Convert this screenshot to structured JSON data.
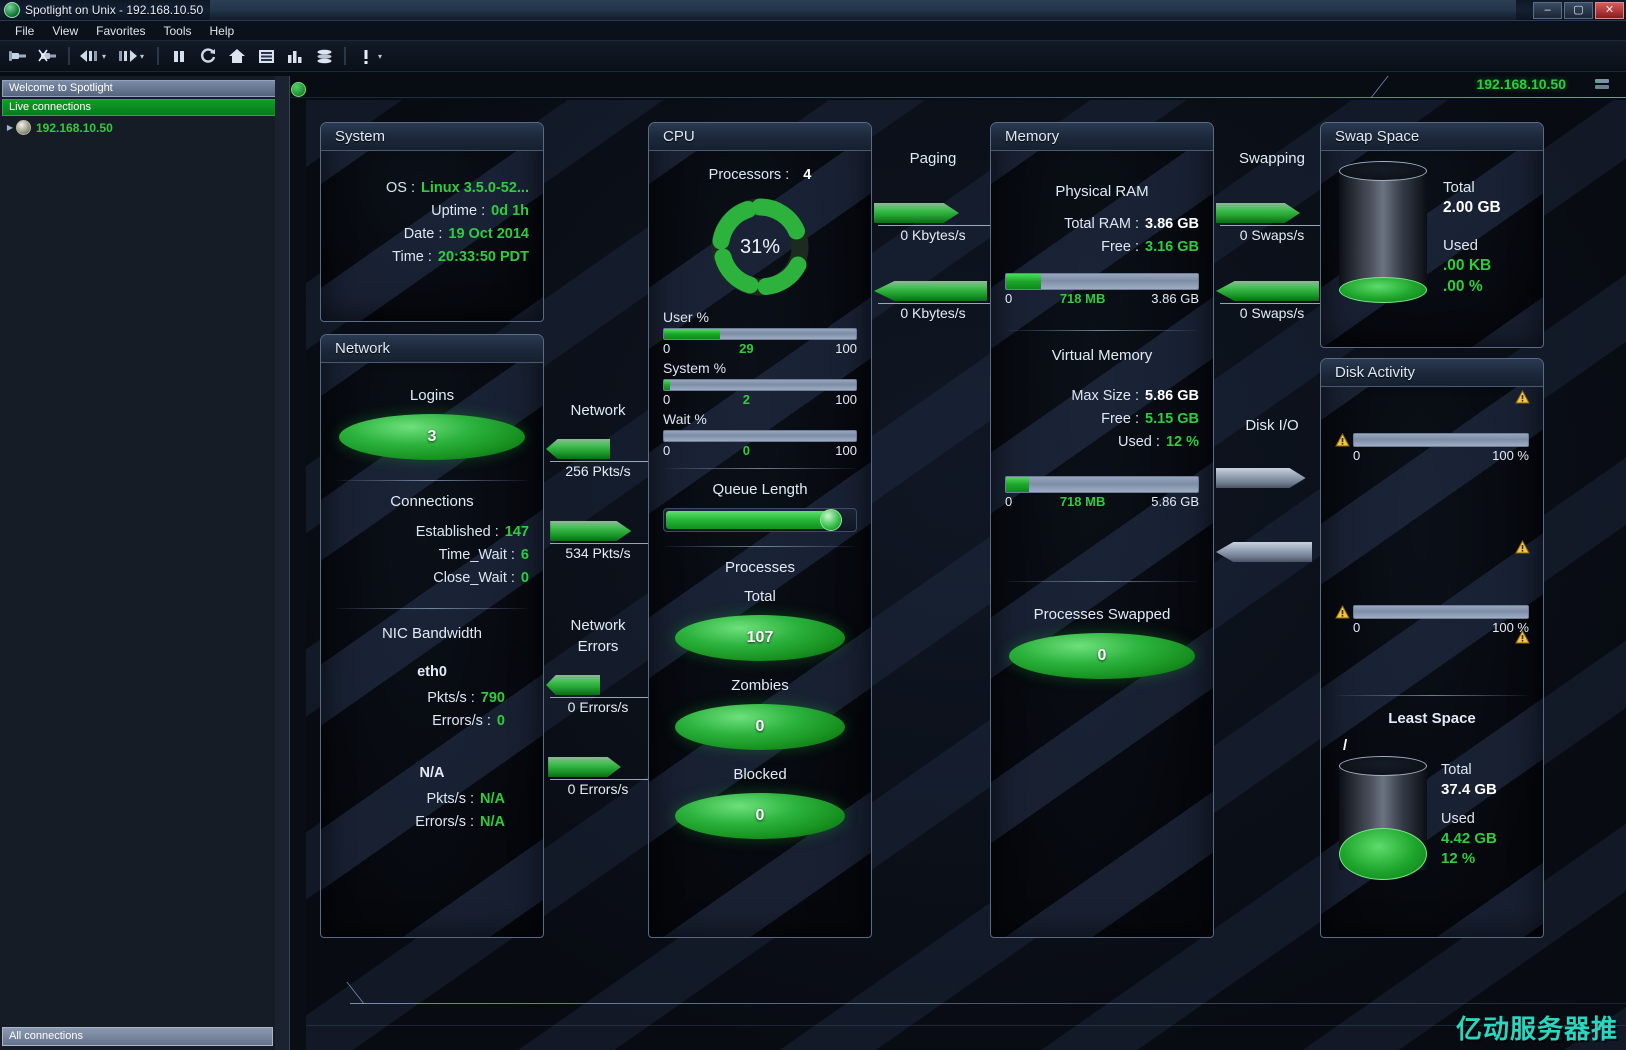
{
  "window": {
    "title": "Spotlight on Unix - 192.168.10.50",
    "minimize": "–",
    "maximize": "▢",
    "close": "✕"
  },
  "menubar": [
    {
      "label": "File"
    },
    {
      "label": "View"
    },
    {
      "label": "Favorites"
    },
    {
      "label": "Tools"
    },
    {
      "label": "Help"
    }
  ],
  "toolbar": [
    {
      "name": "connect-icon",
      "glyph": "⚊"
    },
    {
      "name": "disconnect-icon",
      "glyph": "⚊"
    },
    {
      "name": "back-icon",
      "glyph": "◀"
    },
    {
      "name": "forward-icon",
      "glyph": "▶"
    },
    {
      "name": "pause-icon",
      "glyph": "❚❚"
    },
    {
      "name": "refresh-icon",
      "glyph": "↻"
    },
    {
      "name": "home-icon",
      "glyph": "⌂"
    },
    {
      "name": "grid-icon",
      "glyph": "▤"
    },
    {
      "name": "chart-icon",
      "glyph": "▮"
    },
    {
      "name": "database-icon",
      "glyph": "☰"
    },
    {
      "name": "alarm-icon",
      "glyph": "❗"
    }
  ],
  "banner": {
    "ip": "192.168.10.50"
  },
  "sidebar": {
    "welcome_header": "Welcome to Spotlight",
    "live_connections": "Live connections",
    "node": "192.168.10.50",
    "status": "All connections"
  },
  "system": {
    "title": "System",
    "rows": [
      {
        "label": "OS :",
        "value": "Linux  3.5.0-52...",
        "style": "green"
      },
      {
        "label": "Uptime :",
        "value": "0d 1h",
        "style": "green"
      },
      {
        "label": "Date :",
        "value": "19 Oct 2014",
        "style": "green"
      },
      {
        "label": "Time :",
        "value": "20:33:50 PDT",
        "style": "green"
      }
    ]
  },
  "network_panel": {
    "title": "Network",
    "logins_label": "Logins",
    "logins_value": "3",
    "connections_label": "Connections",
    "connections": [
      {
        "label": "Established :",
        "value": "147"
      },
      {
        "label": "Time_Wait :",
        "value": "6"
      },
      {
        "label": "Close_Wait :",
        "value": "0"
      }
    ],
    "nic_label": "NIC Bandwidth",
    "nics": [
      {
        "name": "eth0",
        "rows": [
          {
            "label": "Pkts/s :",
            "value": "790"
          },
          {
            "label": "Errors/s :",
            "value": "0"
          }
        ]
      },
      {
        "name": "N/A",
        "rows": [
          {
            "label": "Pkts/s :",
            "value": "N/A"
          },
          {
            "label": "Errors/s :",
            "value": "N/A"
          }
        ]
      }
    ]
  },
  "network_flow": {
    "title1": "Network",
    "flows1": [
      {
        "value": "256 Pkts/s",
        "dir": "left",
        "fill": 62
      },
      {
        "value": "534 Pkts/s",
        "dir": "right",
        "fill": 78
      }
    ],
    "title2a": "Network",
    "title2b": "Errors",
    "flows2": [
      {
        "value": "0 Errors/s",
        "dir": "left",
        "fill": 52
      },
      {
        "value": "0 Errors/s",
        "dir": "right",
        "fill": 70
      }
    ]
  },
  "cpu": {
    "title": "CPU",
    "processors_label": "Processors :",
    "processors_value": "4",
    "dial_value": "31%",
    "bars": [
      {
        "label": "User %",
        "min": "0",
        "cur": "29",
        "max": "100",
        "fill": 29
      },
      {
        "label": "System %",
        "min": "0",
        "cur": "2",
        "max": "100",
        "fill": 3
      },
      {
        "label": "Wait %",
        "min": "0",
        "cur": "0",
        "max": "100",
        "fill": 0
      }
    ],
    "queue_label": "Queue Length",
    "queue_fill": 86,
    "processes_label": "Processes",
    "processes": [
      {
        "label": "Total",
        "value": "107"
      },
      {
        "label": "Zombies",
        "value": "0"
      },
      {
        "label": "Blocked",
        "value": "0"
      }
    ]
  },
  "paging": {
    "title": "Paging",
    "flows": [
      {
        "value": "0 Kbytes/s",
        "dir": "right",
        "fill": 72
      },
      {
        "value": "0 Kbytes/s",
        "dir": "left",
        "fill": 96
      }
    ]
  },
  "memory": {
    "title": "Memory",
    "physical_label": "Physical RAM",
    "physical_rows": [
      {
        "label": "Total RAM :",
        "value": "3.86 GB",
        "style": "white"
      },
      {
        "label": "Free :",
        "value": "3.16 GB",
        "style": "green"
      }
    ],
    "physical_meter": {
      "min": "0",
      "cur": "718 MB",
      "max": "3.86 GB",
      "fill": 18
    },
    "virtual_label": "Virtual Memory",
    "virtual_rows": [
      {
        "label": "Max Size :",
        "value": "5.86 GB",
        "style": "white"
      },
      {
        "label": "Free :",
        "value": "5.15 GB",
        "style": "green"
      },
      {
        "label": "Used :",
        "value": "12 %",
        "style": "green"
      }
    ],
    "virtual_meter": {
      "min": "0",
      "cur": "718 MB",
      "max": "5.86 GB",
      "fill": 12
    },
    "swapped_label": "Processes Swapped",
    "swapped_value": "0"
  },
  "swapping": {
    "title": "Swapping",
    "flows": [
      {
        "value": "0 Swaps/s",
        "dir": "right",
        "fill": 75
      },
      {
        "value": "0 Swaps/s",
        "dir": "left",
        "fill": 92
      }
    ]
  },
  "swap_space": {
    "title": "Swap Space",
    "total_label": "Total",
    "total_value": "2.00 GB",
    "used_label": "Used",
    "used_value": ".00 KB",
    "used_pct": ".00 %",
    "fill_pct": 6
  },
  "disk_io": {
    "title": "Disk I/O",
    "flows": [
      {
        "value": "",
        "dir": "right",
        "fill": 80
      },
      {
        "value": "",
        "dir": "left",
        "fill": 86
      }
    ]
  },
  "disk_activity": {
    "title": "Disk Activity",
    "meters": [
      {
        "min": "0",
        "max": "100 %",
        "fill": 0
      },
      {
        "min": "0",
        "max": "100 %",
        "fill": 0
      }
    ],
    "least_space_label": "Least Space",
    "mount": "/",
    "total_label": "Total",
    "total_value": "37.4 GB",
    "used_label": "Used",
    "used_value": "4.42 GB",
    "used_pct": "12 %",
    "fill_pct": 26
  },
  "watermark": "亿动服务器推",
  "colors": {
    "green": "#2ecc3f",
    "panel_title": "#dfe8f5",
    "label": "#dde6f2"
  }
}
